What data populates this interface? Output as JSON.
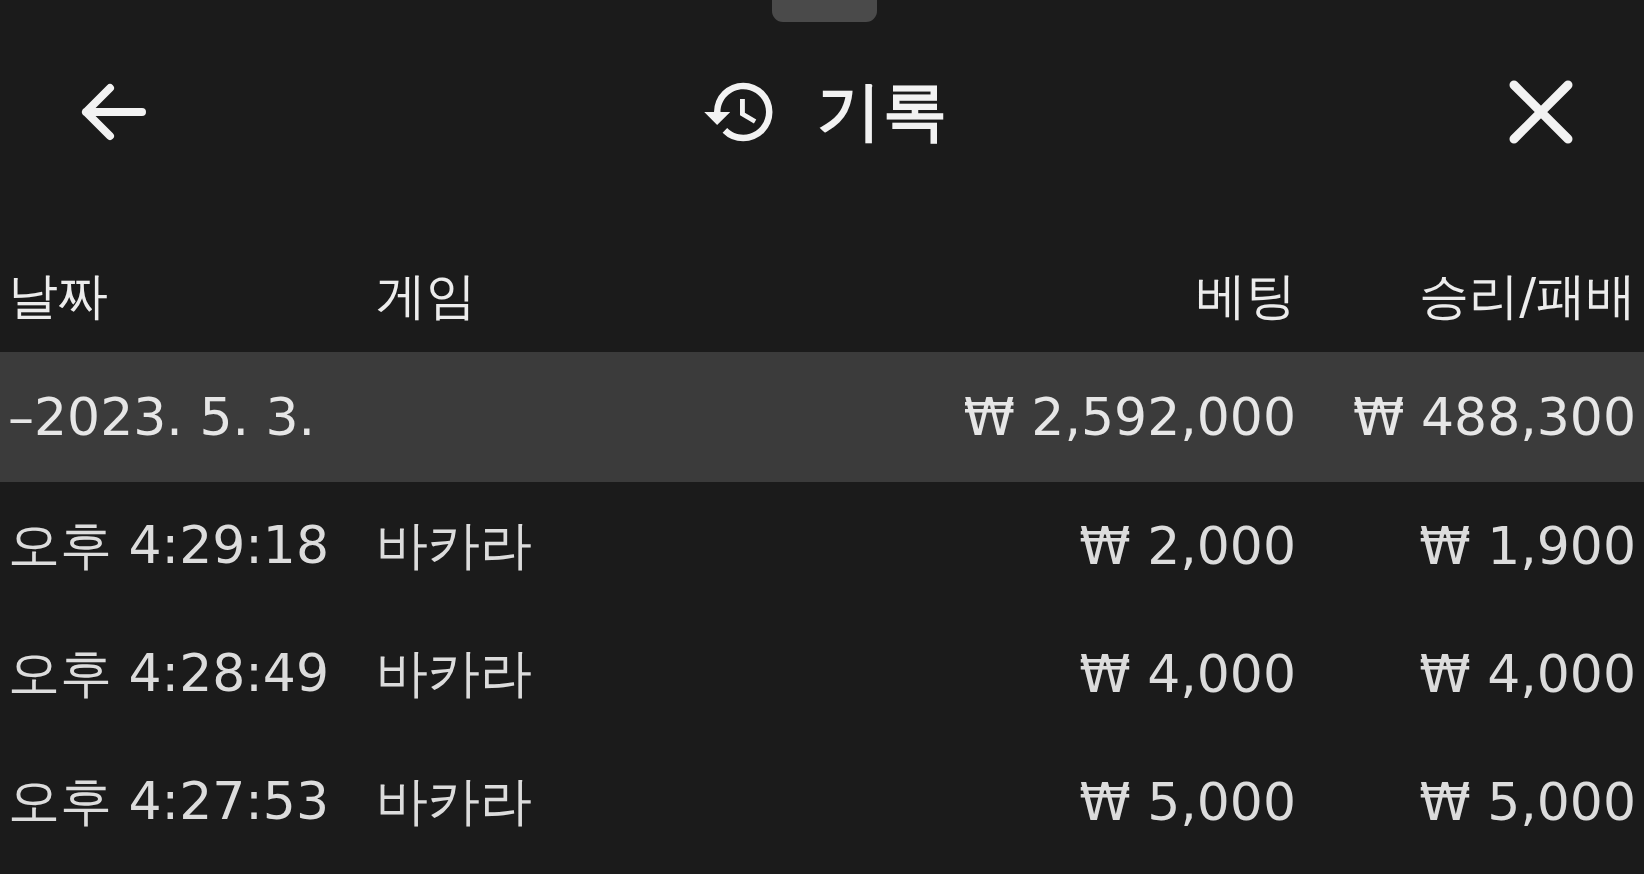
{
  "header": {
    "title": "기록"
  },
  "table": {
    "columns": [
      "날짜",
      "게임",
      "베팅",
      "승리/패배"
    ],
    "group": {
      "date": "–2023. 5. 3.",
      "bet": "₩ 2,592,000",
      "result": "₩ 488,300"
    },
    "rows": [
      {
        "time": "오후 4:29:18",
        "game": "바카라",
        "bet": "₩ 2,000",
        "result": "₩ 1,900"
      },
      {
        "time": "오후 4:28:49",
        "game": "바카라",
        "bet": "₩ 4,000",
        "result": "₩ 4,000"
      },
      {
        "time": "오후 4:27:53",
        "game": "바카라",
        "bet": "₩ 5,000",
        "result": "₩ 5,000"
      }
    ]
  }
}
